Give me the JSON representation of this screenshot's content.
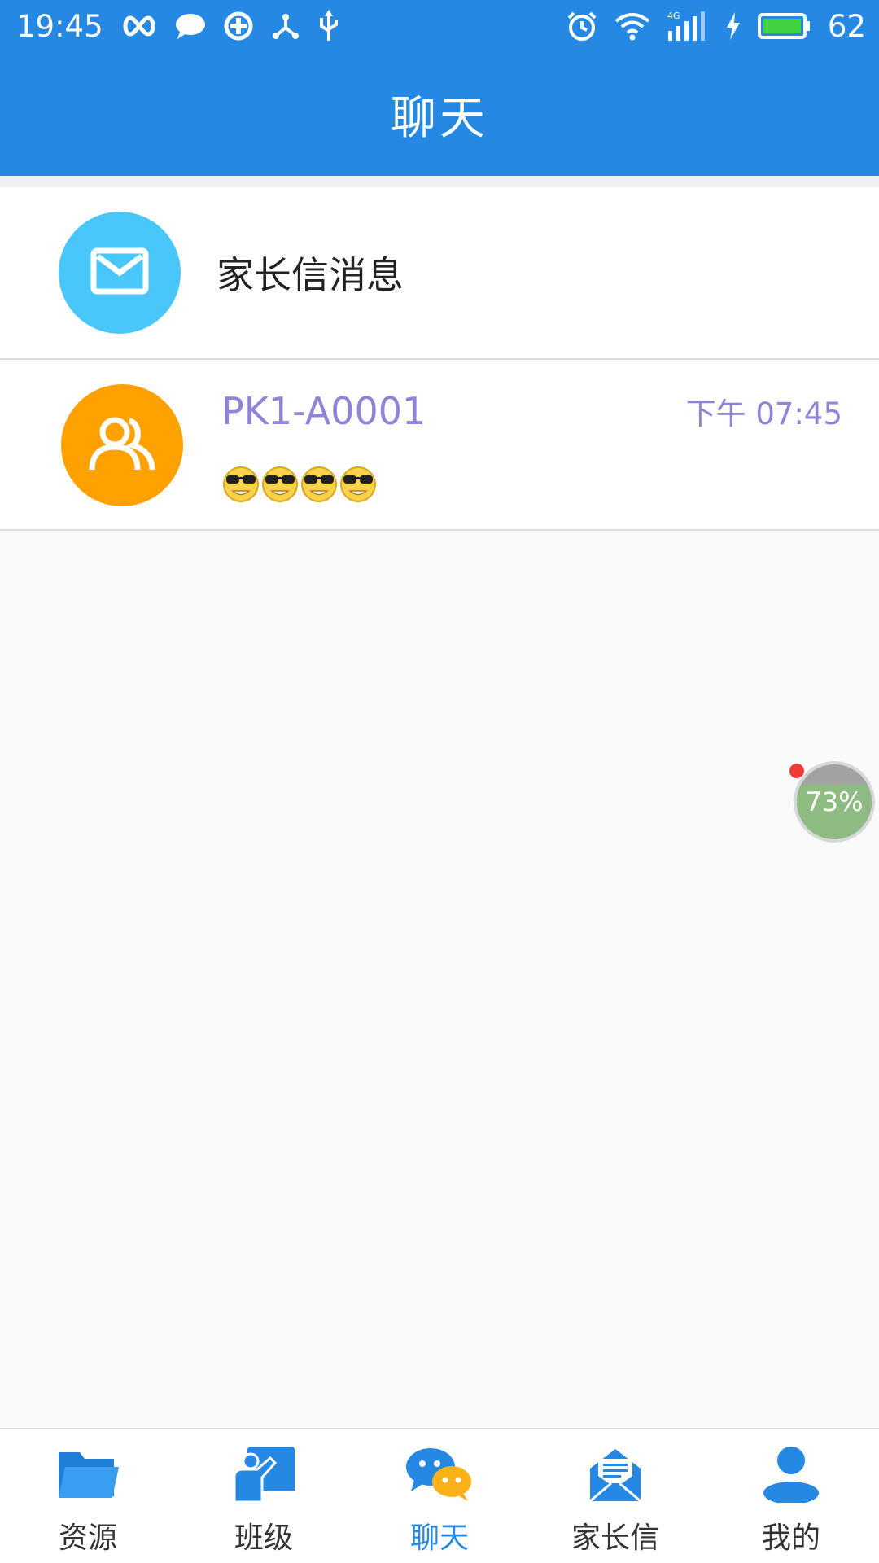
{
  "status_bar": {
    "time": "19:45",
    "battery_level": "62"
  },
  "header": {
    "title": "聊天"
  },
  "list": {
    "notice_row": {
      "title": "家长信消息",
      "icon": "mail-icon"
    },
    "conversation": {
      "name": "PK1-A0001",
      "time": "下午 07:45",
      "preview_emoji_count": 4,
      "avatar_icon": "group-icon"
    }
  },
  "floating_widget": {
    "label": "73%",
    "percent": 73
  },
  "tabbar": {
    "tabs": [
      {
        "label": "资源",
        "icon": "folder-icon",
        "active": false
      },
      {
        "label": "班级",
        "icon": "class-board-icon",
        "active": false
      },
      {
        "label": "聊天",
        "icon": "chat-icon",
        "active": true
      },
      {
        "label": "家长信",
        "icon": "letter-icon",
        "active": false
      },
      {
        "label": "我的",
        "icon": "person-icon",
        "active": false
      }
    ]
  },
  "colors": {
    "primary": "#2589e3",
    "mail_avatar": "#49c6fa",
    "group_avatar": "#ffa200",
    "accent_text": "#8f84d9"
  }
}
